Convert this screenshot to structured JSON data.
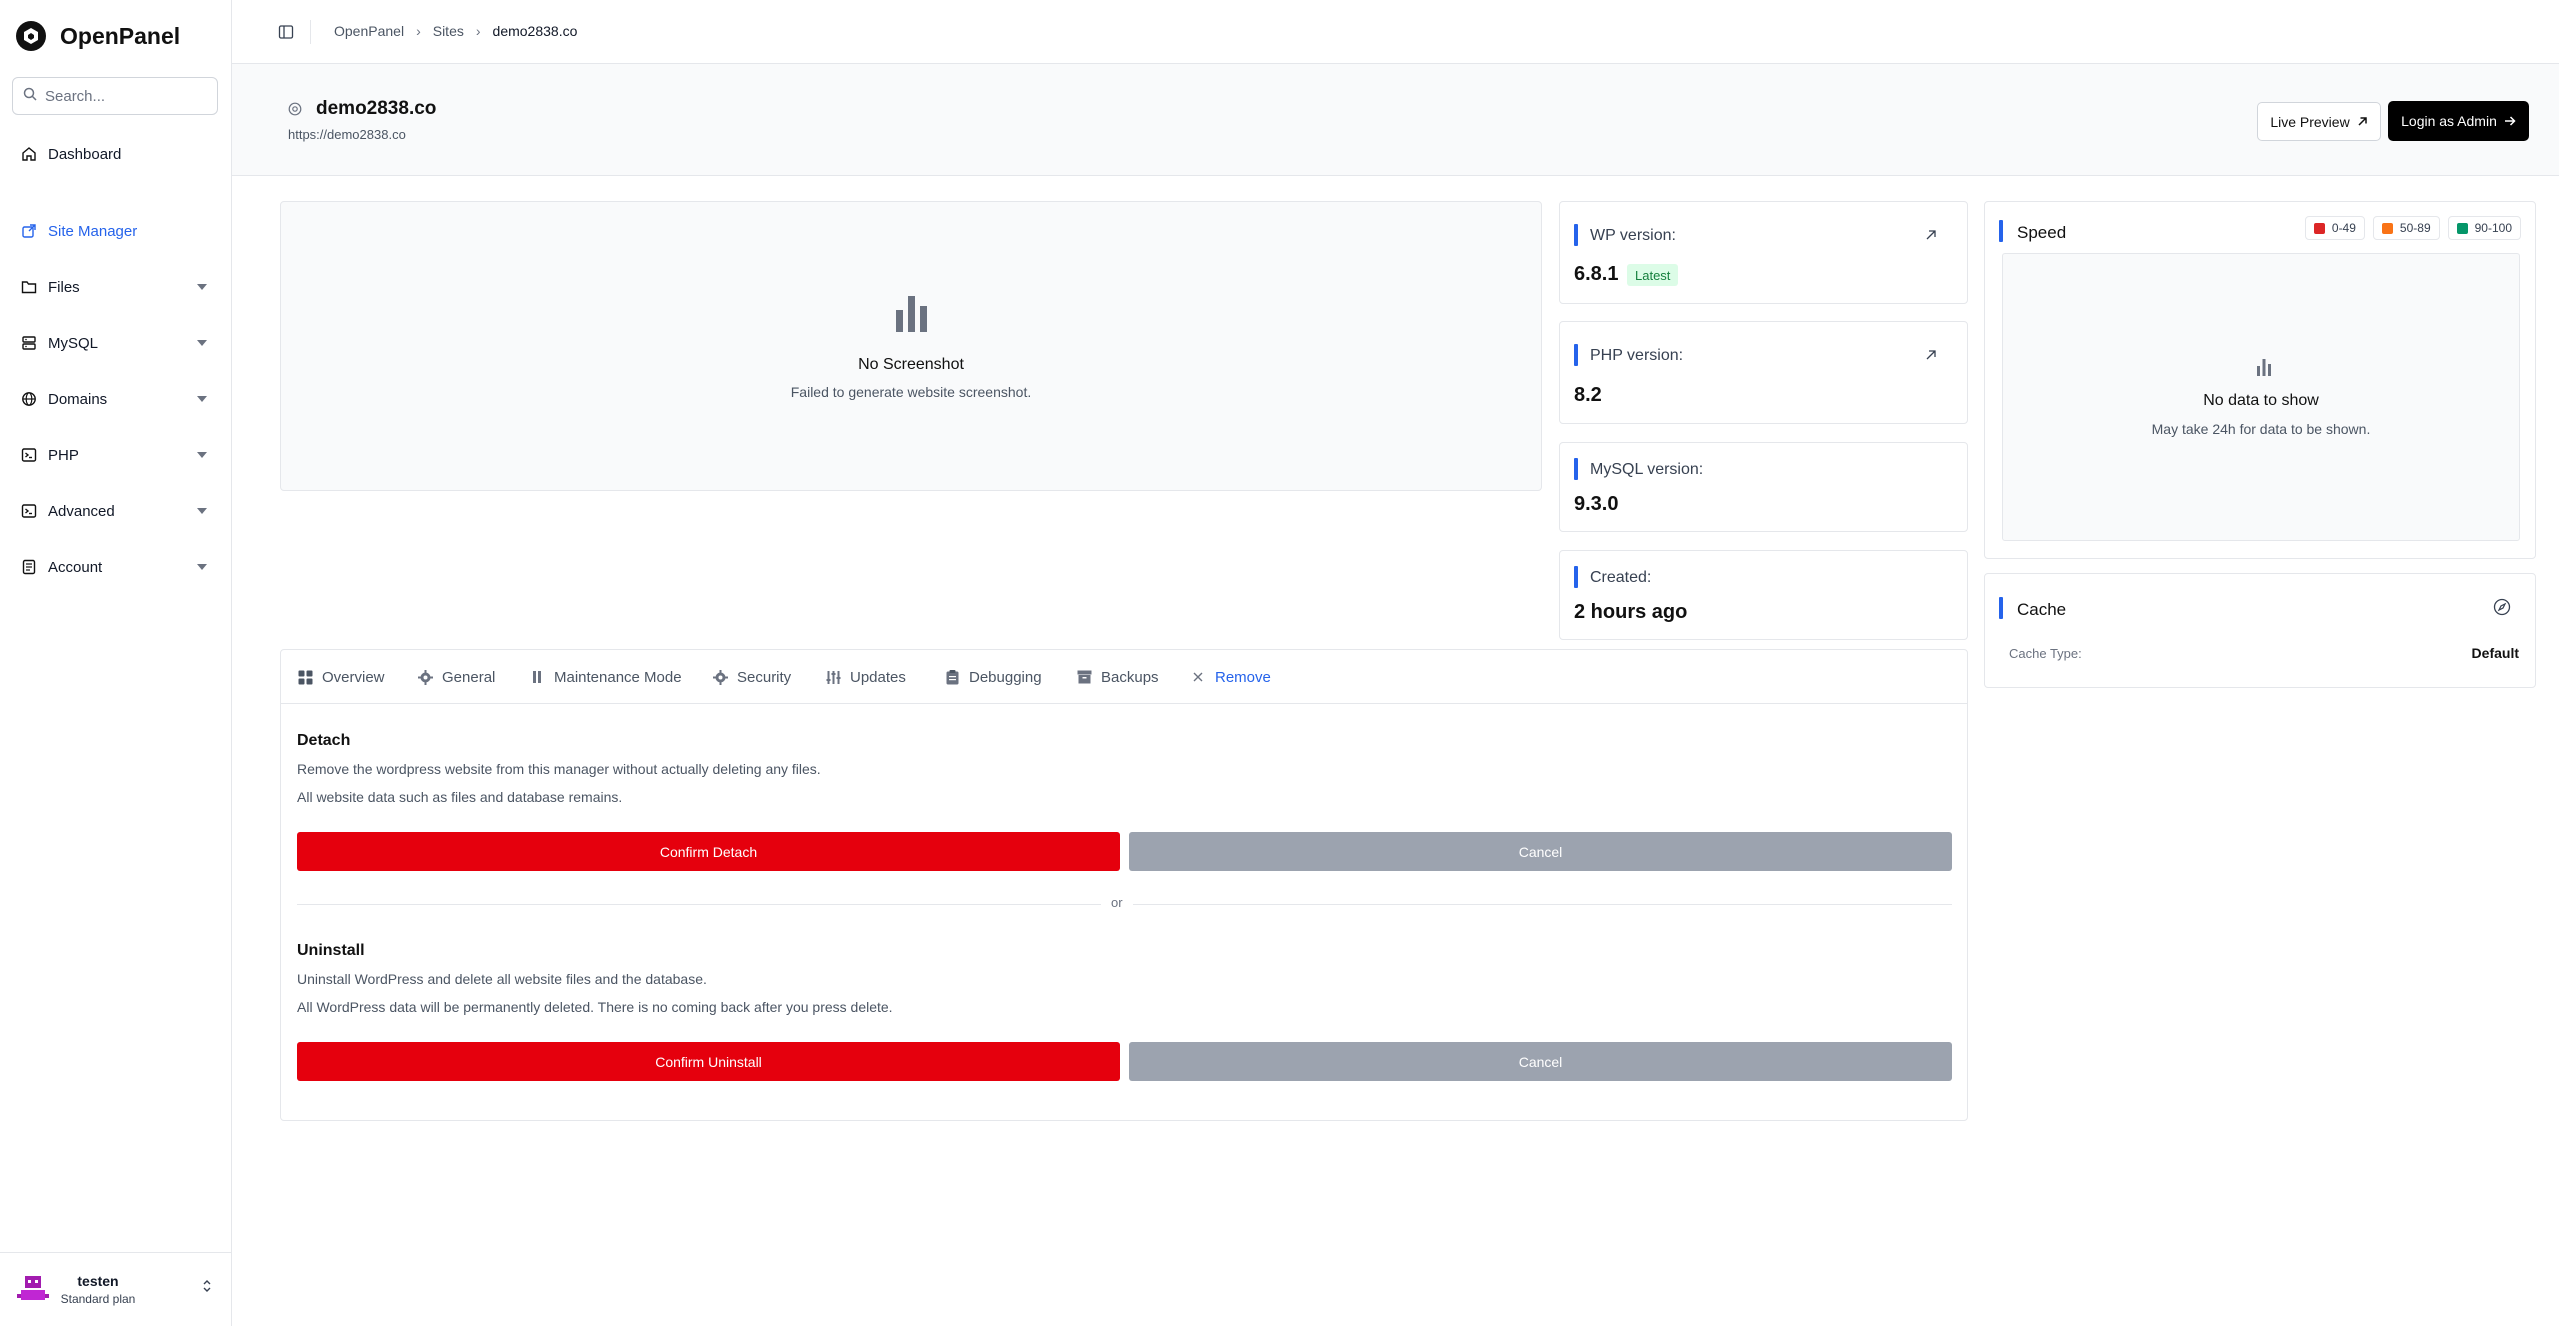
{
  "brand": {
    "name": "OpenPanel"
  },
  "search": {
    "placeholder": "Search..."
  },
  "sidebar": {
    "items": [
      {
        "label": "Dashboard",
        "icon": "home-icon"
      },
      {
        "label": "Site Manager",
        "icon": "site-manager-icon",
        "active": true
      },
      {
        "label": "Files",
        "icon": "folder-icon"
      },
      {
        "label": "MySQL",
        "icon": "database-icon"
      },
      {
        "label": "Domains",
        "icon": "globe-icon"
      },
      {
        "label": "PHP",
        "icon": "terminal-icon"
      },
      {
        "label": "Advanced",
        "icon": "terminal-icon"
      },
      {
        "label": "Account",
        "icon": "account-icon"
      }
    ]
  },
  "user": {
    "name": "testen",
    "plan": "Standard plan"
  },
  "breadcrumb": {
    "root": "OpenPanel",
    "section": "Sites",
    "current": "demo2838.co"
  },
  "site": {
    "title": "demo2838.co",
    "url": "https://demo2838.co"
  },
  "actions": {
    "live_preview": "Live Preview",
    "login_admin": "Login as Admin"
  },
  "screenshot": {
    "title": "No Screenshot",
    "subtitle": "Failed to generate website screenshot."
  },
  "info": {
    "wp": {
      "label": "WP version:",
      "value": "6.8.1",
      "badge": "Latest"
    },
    "php": {
      "label": "PHP version:",
      "value": "8.2"
    },
    "mysql": {
      "label": "MySQL version:",
      "value": "9.3.0"
    },
    "created": {
      "label": "Created:",
      "value": "2 hours ago"
    }
  },
  "speed": {
    "title": "Speed",
    "legend": [
      {
        "label": "0-49",
        "color": "#dc2626"
      },
      {
        "label": "50-89",
        "color": "#f97316"
      },
      {
        "label": "90-100",
        "color": "#059669"
      }
    ],
    "empty_title": "No data to show",
    "empty_hint": "May take 24h for data to be shown."
  },
  "cache": {
    "title": "Cache",
    "type_label": "Cache Type:",
    "type_value": "Default"
  },
  "tabs": [
    {
      "label": "Overview"
    },
    {
      "label": "General"
    },
    {
      "label": "Maintenance Mode"
    },
    {
      "label": "Security"
    },
    {
      "label": "Updates"
    },
    {
      "label": "Debugging"
    },
    {
      "label": "Backups"
    },
    {
      "label": "Remove",
      "active": true
    }
  ],
  "remove": {
    "detach": {
      "title": "Detach",
      "line1": "Remove the wordpress website from this manager without actually deleting any files.",
      "line2": "All website data such as files and database remains.",
      "confirm": "Confirm Detach",
      "cancel": "Cancel"
    },
    "or": "or",
    "uninstall": {
      "title": "Uninstall",
      "line1": "Uninstall WordPress and delete all website files and the database.",
      "line2": "All WordPress data will be permanently deleted. There is no coming back after you press delete.",
      "confirm": "Confirm Uninstall",
      "cancel": "Cancel"
    }
  },
  "colors": {
    "accent": "#2563eb",
    "danger": "#e5000d",
    "muted_button": "#9ca3af"
  }
}
